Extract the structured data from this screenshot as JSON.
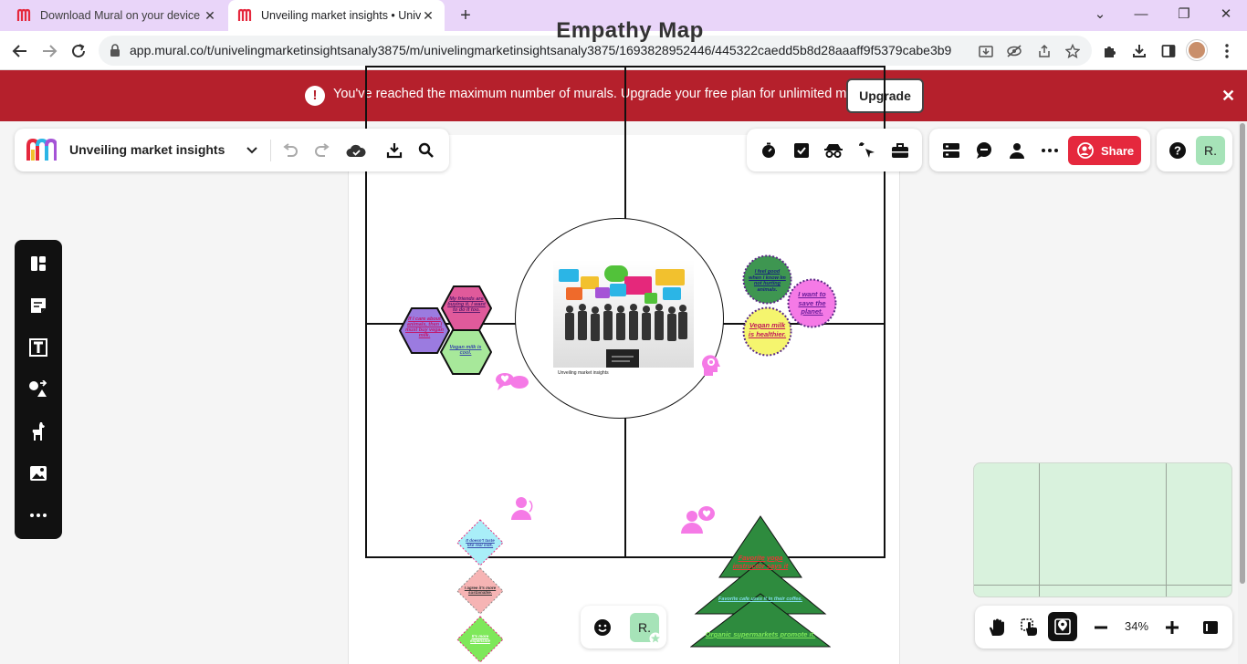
{
  "browser": {
    "tabs": [
      {
        "title": "Download Mural on your device",
        "active": false
      },
      {
        "title": "Unveiling market insights • Univ",
        "active": true
      }
    ],
    "url": "app.mural.co/t/univelingmarketinsightsanaly3875/m/univelingmarketinsightsanaly3875/1693828952446/445322caedd5b8d28aaaff9f5379cabe3b92..."
  },
  "banner": {
    "message": "You've reached the maximum number of murals. Upgrade your free plan for unlimited murals.",
    "upgrade_label": "Upgrade",
    "color": "#b5202c"
  },
  "header": {
    "mural_name": "Unveiling market insights",
    "share_label": "Share",
    "user_initial": "R."
  },
  "board": {
    "title": "Empathy  Map",
    "center_caption": "Unveiling market insights",
    "hexagons": [
      {
        "text": "My friends are buying it. I want to do it too.",
        "color": "#e05a9b"
      },
      {
        "text": "If I care about animals, then I must buy vegan milk.",
        "color": "#9b7be0"
      },
      {
        "text": "Vegan milk is cool.",
        "color": "#a7e89a"
      }
    ],
    "circles": [
      {
        "text": "I feel good when I know Im not hurting animals.",
        "color": "#3e9651"
      },
      {
        "text": "I want to save the planet.",
        "color": "#f57ae6"
      },
      {
        "text": "Vegan milk is healthier.",
        "color": "#f5f56e"
      }
    ],
    "diamonds": [
      {
        "text": "It doesn't taste like real milk.",
        "color": "#a9eef8"
      },
      {
        "text": "I agree it's more sustainable.",
        "color": "#f6b4b4"
      },
      {
        "text": "It's more expensive",
        "color": "#7ee85a"
      }
    ],
    "triangles": [
      {
        "text": "Favorite yoga instructor says it",
        "color": "#2e8b3e"
      },
      {
        "text": "Favorite cafe uses it in their coffee.",
        "color": "#2e8b3e"
      },
      {
        "text": "Organic supermarkets promote it.",
        "color": "#2e8b3e"
      }
    ]
  },
  "bottom": {
    "zoom": "34%",
    "user_initial": "R."
  }
}
